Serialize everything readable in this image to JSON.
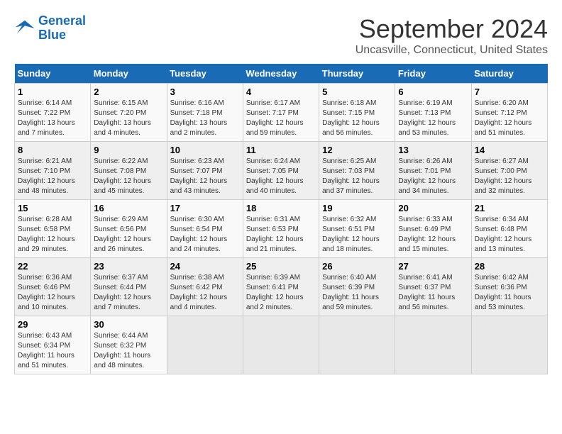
{
  "logo": {
    "line1": "General",
    "line2": "Blue"
  },
  "title": "September 2024",
  "location": "Uncasville, Connecticut, United States",
  "days_of_week": [
    "Sunday",
    "Monday",
    "Tuesday",
    "Wednesday",
    "Thursday",
    "Friday",
    "Saturday"
  ],
  "weeks": [
    [
      {
        "day": "1",
        "info": "Sunrise: 6:14 AM\nSunset: 7:22 PM\nDaylight: 13 hours\nand 7 minutes."
      },
      {
        "day": "2",
        "info": "Sunrise: 6:15 AM\nSunset: 7:20 PM\nDaylight: 13 hours\nand 4 minutes."
      },
      {
        "day": "3",
        "info": "Sunrise: 6:16 AM\nSunset: 7:18 PM\nDaylight: 13 hours\nand 2 minutes."
      },
      {
        "day": "4",
        "info": "Sunrise: 6:17 AM\nSunset: 7:17 PM\nDaylight: 12 hours\nand 59 minutes."
      },
      {
        "day": "5",
        "info": "Sunrise: 6:18 AM\nSunset: 7:15 PM\nDaylight: 12 hours\nand 56 minutes."
      },
      {
        "day": "6",
        "info": "Sunrise: 6:19 AM\nSunset: 7:13 PM\nDaylight: 12 hours\nand 53 minutes."
      },
      {
        "day": "7",
        "info": "Sunrise: 6:20 AM\nSunset: 7:12 PM\nDaylight: 12 hours\nand 51 minutes."
      }
    ],
    [
      {
        "day": "8",
        "info": "Sunrise: 6:21 AM\nSunset: 7:10 PM\nDaylight: 12 hours\nand 48 minutes."
      },
      {
        "day": "9",
        "info": "Sunrise: 6:22 AM\nSunset: 7:08 PM\nDaylight: 12 hours\nand 45 minutes."
      },
      {
        "day": "10",
        "info": "Sunrise: 6:23 AM\nSunset: 7:07 PM\nDaylight: 12 hours\nand 43 minutes."
      },
      {
        "day": "11",
        "info": "Sunrise: 6:24 AM\nSunset: 7:05 PM\nDaylight: 12 hours\nand 40 minutes."
      },
      {
        "day": "12",
        "info": "Sunrise: 6:25 AM\nSunset: 7:03 PM\nDaylight: 12 hours\nand 37 minutes."
      },
      {
        "day": "13",
        "info": "Sunrise: 6:26 AM\nSunset: 7:01 PM\nDaylight: 12 hours\nand 34 minutes."
      },
      {
        "day": "14",
        "info": "Sunrise: 6:27 AM\nSunset: 7:00 PM\nDaylight: 12 hours\nand 32 minutes."
      }
    ],
    [
      {
        "day": "15",
        "info": "Sunrise: 6:28 AM\nSunset: 6:58 PM\nDaylight: 12 hours\nand 29 minutes."
      },
      {
        "day": "16",
        "info": "Sunrise: 6:29 AM\nSunset: 6:56 PM\nDaylight: 12 hours\nand 26 minutes."
      },
      {
        "day": "17",
        "info": "Sunrise: 6:30 AM\nSunset: 6:54 PM\nDaylight: 12 hours\nand 24 minutes."
      },
      {
        "day": "18",
        "info": "Sunrise: 6:31 AM\nSunset: 6:53 PM\nDaylight: 12 hours\nand 21 minutes."
      },
      {
        "day": "19",
        "info": "Sunrise: 6:32 AM\nSunset: 6:51 PM\nDaylight: 12 hours\nand 18 minutes."
      },
      {
        "day": "20",
        "info": "Sunrise: 6:33 AM\nSunset: 6:49 PM\nDaylight: 12 hours\nand 15 minutes."
      },
      {
        "day": "21",
        "info": "Sunrise: 6:34 AM\nSunset: 6:48 PM\nDaylight: 12 hours\nand 13 minutes."
      }
    ],
    [
      {
        "day": "22",
        "info": "Sunrise: 6:36 AM\nSunset: 6:46 PM\nDaylight: 12 hours\nand 10 minutes."
      },
      {
        "day": "23",
        "info": "Sunrise: 6:37 AM\nSunset: 6:44 PM\nDaylight: 12 hours\nand 7 minutes."
      },
      {
        "day": "24",
        "info": "Sunrise: 6:38 AM\nSunset: 6:42 PM\nDaylight: 12 hours\nand 4 minutes."
      },
      {
        "day": "25",
        "info": "Sunrise: 6:39 AM\nSunset: 6:41 PM\nDaylight: 12 hours\nand 2 minutes."
      },
      {
        "day": "26",
        "info": "Sunrise: 6:40 AM\nSunset: 6:39 PM\nDaylight: 11 hours\nand 59 minutes."
      },
      {
        "day": "27",
        "info": "Sunrise: 6:41 AM\nSunset: 6:37 PM\nDaylight: 11 hours\nand 56 minutes."
      },
      {
        "day": "28",
        "info": "Sunrise: 6:42 AM\nSunset: 6:36 PM\nDaylight: 11 hours\nand 53 minutes."
      }
    ],
    [
      {
        "day": "29",
        "info": "Sunrise: 6:43 AM\nSunset: 6:34 PM\nDaylight: 11 hours\nand 51 minutes."
      },
      {
        "day": "30",
        "info": "Sunrise: 6:44 AM\nSunset: 6:32 PM\nDaylight: 11 hours\nand 48 minutes."
      },
      {
        "day": "",
        "info": ""
      },
      {
        "day": "",
        "info": ""
      },
      {
        "day": "",
        "info": ""
      },
      {
        "day": "",
        "info": ""
      },
      {
        "day": "",
        "info": ""
      }
    ]
  ]
}
